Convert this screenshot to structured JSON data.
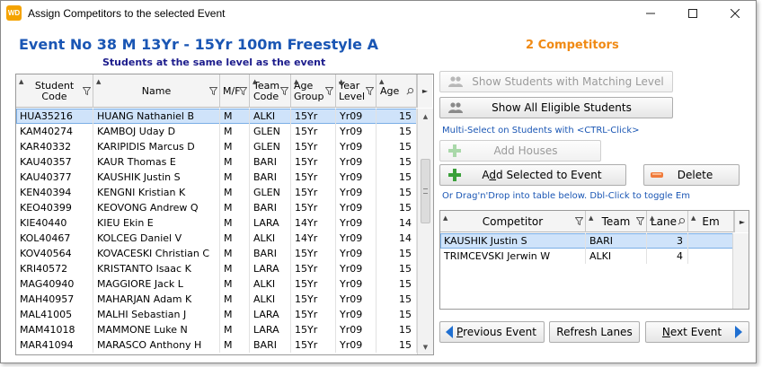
{
  "window": {
    "logo_text": "WD",
    "title": "Assign Competitors to the selected Event"
  },
  "event": {
    "title": "Event No 38 M 13Yr - 15Yr 100m Freestyle A",
    "subtitle": "Students at the same level as the event",
    "competitor_count": "2 Competitors"
  },
  "students_table": {
    "columns": [
      "Student Code",
      "Name",
      "M/F",
      "Team Code",
      "Age Group",
      "Year Level",
      "Age"
    ],
    "rows": [
      [
        "HUA35216",
        "HUANG Nathaniel B",
        "M",
        "ALKI",
        "15Yr",
        "Yr09",
        "15"
      ],
      [
        "KAM40274",
        "KAMBOJ Uday D",
        "M",
        "GLEN",
        "15Yr",
        "Yr09",
        "15"
      ],
      [
        "KAR40332",
        "KARIPIDIS Marcus D",
        "M",
        "GLEN",
        "15Yr",
        "Yr09",
        "15"
      ],
      [
        "KAU40357",
        "KAUR Thomas E",
        "M",
        "BARI",
        "15Yr",
        "Yr09",
        "15"
      ],
      [
        "KAU40377",
        "KAUSHIK Justin S",
        "M",
        "BARI",
        "15Yr",
        "Yr09",
        "15"
      ],
      [
        "KEN40394",
        "KENGNI Kristian K",
        "M",
        "GLEN",
        "15Yr",
        "Yr09",
        "15"
      ],
      [
        "KEO40399",
        "KEOVONG Andrew Q",
        "M",
        "BARI",
        "15Yr",
        "Yr09",
        "15"
      ],
      [
        "KIE40440",
        "KIEU Ekin E",
        "M",
        "LARA",
        "14Yr",
        "Yr09",
        "14"
      ],
      [
        "KOL40467",
        "KOLCEG Daniel V",
        "M",
        "ALKI",
        "14Yr",
        "Yr09",
        "14"
      ],
      [
        "KOV40564",
        "KOVACESKI Christian C",
        "M",
        "BARI",
        "15Yr",
        "Yr09",
        "15"
      ],
      [
        "KRI40572",
        "KRISTANTO Isaac K",
        "M",
        "LARA",
        "15Yr",
        "Yr09",
        "15"
      ],
      [
        "MAG40940",
        "MAGGIORE Jack L",
        "M",
        "ALKI",
        "15Yr",
        "Yr09",
        "15"
      ],
      [
        "MAH40957",
        "MAHARJAN Adam K",
        "M",
        "ALKI",
        "15Yr",
        "Yr09",
        "15"
      ],
      [
        "MAL41005",
        "MALHI Sebastian J",
        "M",
        "LARA",
        "15Yr",
        "Yr09",
        "15"
      ],
      [
        "MAM41018",
        "MAMMONE Luke N",
        "M",
        "LARA",
        "15Yr",
        "Yr09",
        "15"
      ],
      [
        "MAR41094",
        "MARASCO Anthony H",
        "M",
        "BARI",
        "15Yr",
        "Yr09",
        "15"
      ]
    ],
    "selected_row": 0
  },
  "buttons": {
    "show_matching": "Show Students with Matching Level",
    "show_all": "Show All Eligible Students",
    "add_houses": "Add Houses",
    "add_selected_pre": "A",
    "add_selected_ul": "d",
    "add_selected_post": "d Selected to Event",
    "delete": "Delete",
    "previous_ul": "P",
    "previous_post": "revious Event",
    "refresh": "Refresh Lanes",
    "next_ul": "N",
    "next_post": "ext Event"
  },
  "hints": {
    "multi_select": "Multi-Select on Students with <CTRL-Click>",
    "drag_drop": "Or Drag'n'Drop into table below.  Dbl-Click to toggle Em"
  },
  "competitors_table": {
    "columns": [
      "Competitor",
      "Team",
      "Lane",
      "Em"
    ],
    "rows": [
      [
        "KAUSHIK Justin S",
        "BARI",
        "3",
        ""
      ],
      [
        "TRIMCEVSKI Jerwin W",
        "ALKI",
        "4",
        ""
      ]
    ],
    "selected_row": 0
  },
  "colors": {
    "title_blue": "#1a56b4",
    "subtitle_navy": "#1c1c8c",
    "count_orange": "#f08a14",
    "selection": "#cfe3fa",
    "add_green": "#3aa03a",
    "delete_orange": "#f07a3a"
  }
}
